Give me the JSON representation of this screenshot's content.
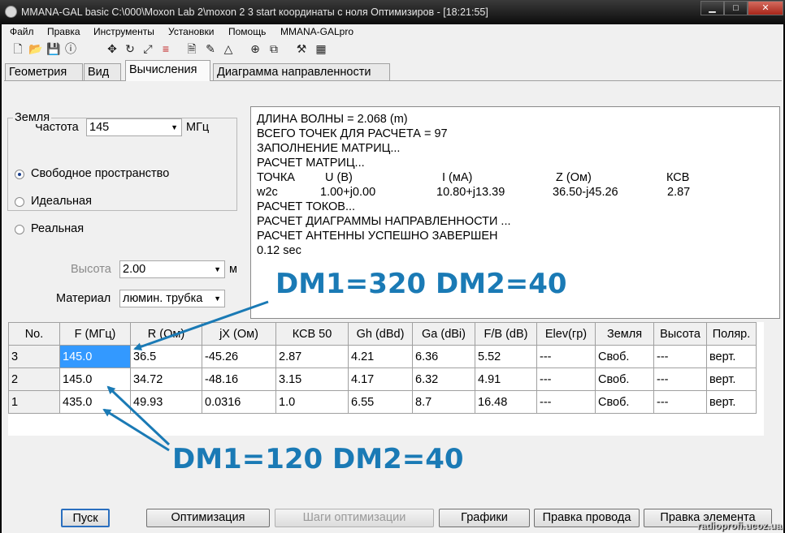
{
  "window": {
    "title": "MMANA-GAL basic C:\\000\\Moxon Lab 2\\moxon 2 3 start координаты с ноля Оптимизиров - [18:21:55]",
    "min_label": "▁",
    "max_label": "□",
    "close_label": "✕"
  },
  "menu": [
    "Файл",
    "Правка",
    "Инструменты",
    "Установки",
    "Помощь",
    "MMANA-GALpro"
  ],
  "toolbar": {
    "icons": [
      "new-file-icon",
      "open-folder-icon",
      "save-icon",
      "info-icon",
      "move-icon",
      "rotate-icon",
      "scale-icon",
      "wires-icon",
      "document-icon",
      "edit-icon",
      "triangle-icon",
      "target-icon",
      "copy-icon",
      "tools-icon",
      "calculator-icon"
    ]
  },
  "tabs": [
    "Геометрия",
    "Вид",
    "Вычисления",
    "Диаграмма направленности"
  ],
  "active_tab": "Вычисления",
  "frequency": {
    "label": "Частота",
    "value": "145",
    "unit": "МГц"
  },
  "ground": {
    "title": "Земля",
    "options": [
      "Свободное пространство",
      "Идеальная",
      "Реальная"
    ],
    "selected": "Свободное пространство"
  },
  "height": {
    "label": "Высота",
    "value": "2.00",
    "unit": "м"
  },
  "material": {
    "label": "Материал",
    "value": "люмин. трубка"
  },
  "output": {
    "lines": [
      "ДЛИНА ВОЛНЫ = 2.068 (m)",
      "ВСЕГО ТОЧЕК ДЛЯ РАСЧЕТА = 97",
      "ЗАПОЛНЕНИЕ МАТРИЦ...",
      "РАСЧЕТ МАТРИЦ..."
    ],
    "point_header": [
      "ТОЧКА",
      "U (B)",
      "I (мА)",
      "Z (Ом)",
      "КСВ"
    ],
    "point_row": [
      "w2c",
      "1.00+j0.00",
      "10.80+j13.39",
      "36.50-j45.26",
      "2.87"
    ],
    "lines_after": [
      "РАСЧЕТ ТОКОВ...",
      "РАСЧЕТ ДИАГРАММЫ НАПРАВЛЕННОСТИ ...",
      "РАСЧЕТ АНТЕННЫ УСПЕШНО ЗАВЕРШЕН",
      "0.12 sec"
    ]
  },
  "table": {
    "columns": [
      "No.",
      "F (МГц)",
      "R (Ом)",
      "jX (Ом)",
      "КСВ 50",
      "Gh (dBd)",
      "Ga (dBi)",
      "F/B (dB)",
      "Elev(гр)",
      "Земля",
      "Высота",
      "Поляр."
    ],
    "rows": [
      [
        "3",
        "145.0",
        "36.5",
        "-45.26",
        "2.87",
        "4.21",
        "6.36",
        "5.52",
        "---",
        "Своб.",
        "---",
        "верт."
      ],
      [
        "2",
        "145.0",
        "34.72",
        "-48.16",
        "3.15",
        "4.17",
        "6.32",
        "4.91",
        "---",
        "Своб.",
        "---",
        "верт."
      ],
      [
        "1",
        "435.0",
        "49.93",
        "0.0316",
        "1.0",
        "6.55",
        "8.7",
        "16.48",
        "---",
        "Своб.",
        "---",
        "верт."
      ]
    ]
  },
  "buttons": {
    "start": "Пуск",
    "optimize": "Оптимизация",
    "opt_steps": "Шаги оптимизации",
    "graphs": "Графики",
    "edit_wire": "Правка провода",
    "edit_element": "Правка элемента"
  },
  "annotations": {
    "top": "DM1=320 DM2=40",
    "bottom": "DM1=120 DM2=40",
    "accent": "#1a7ab5"
  },
  "watermark": "radioprofi.ucoz.ua"
}
